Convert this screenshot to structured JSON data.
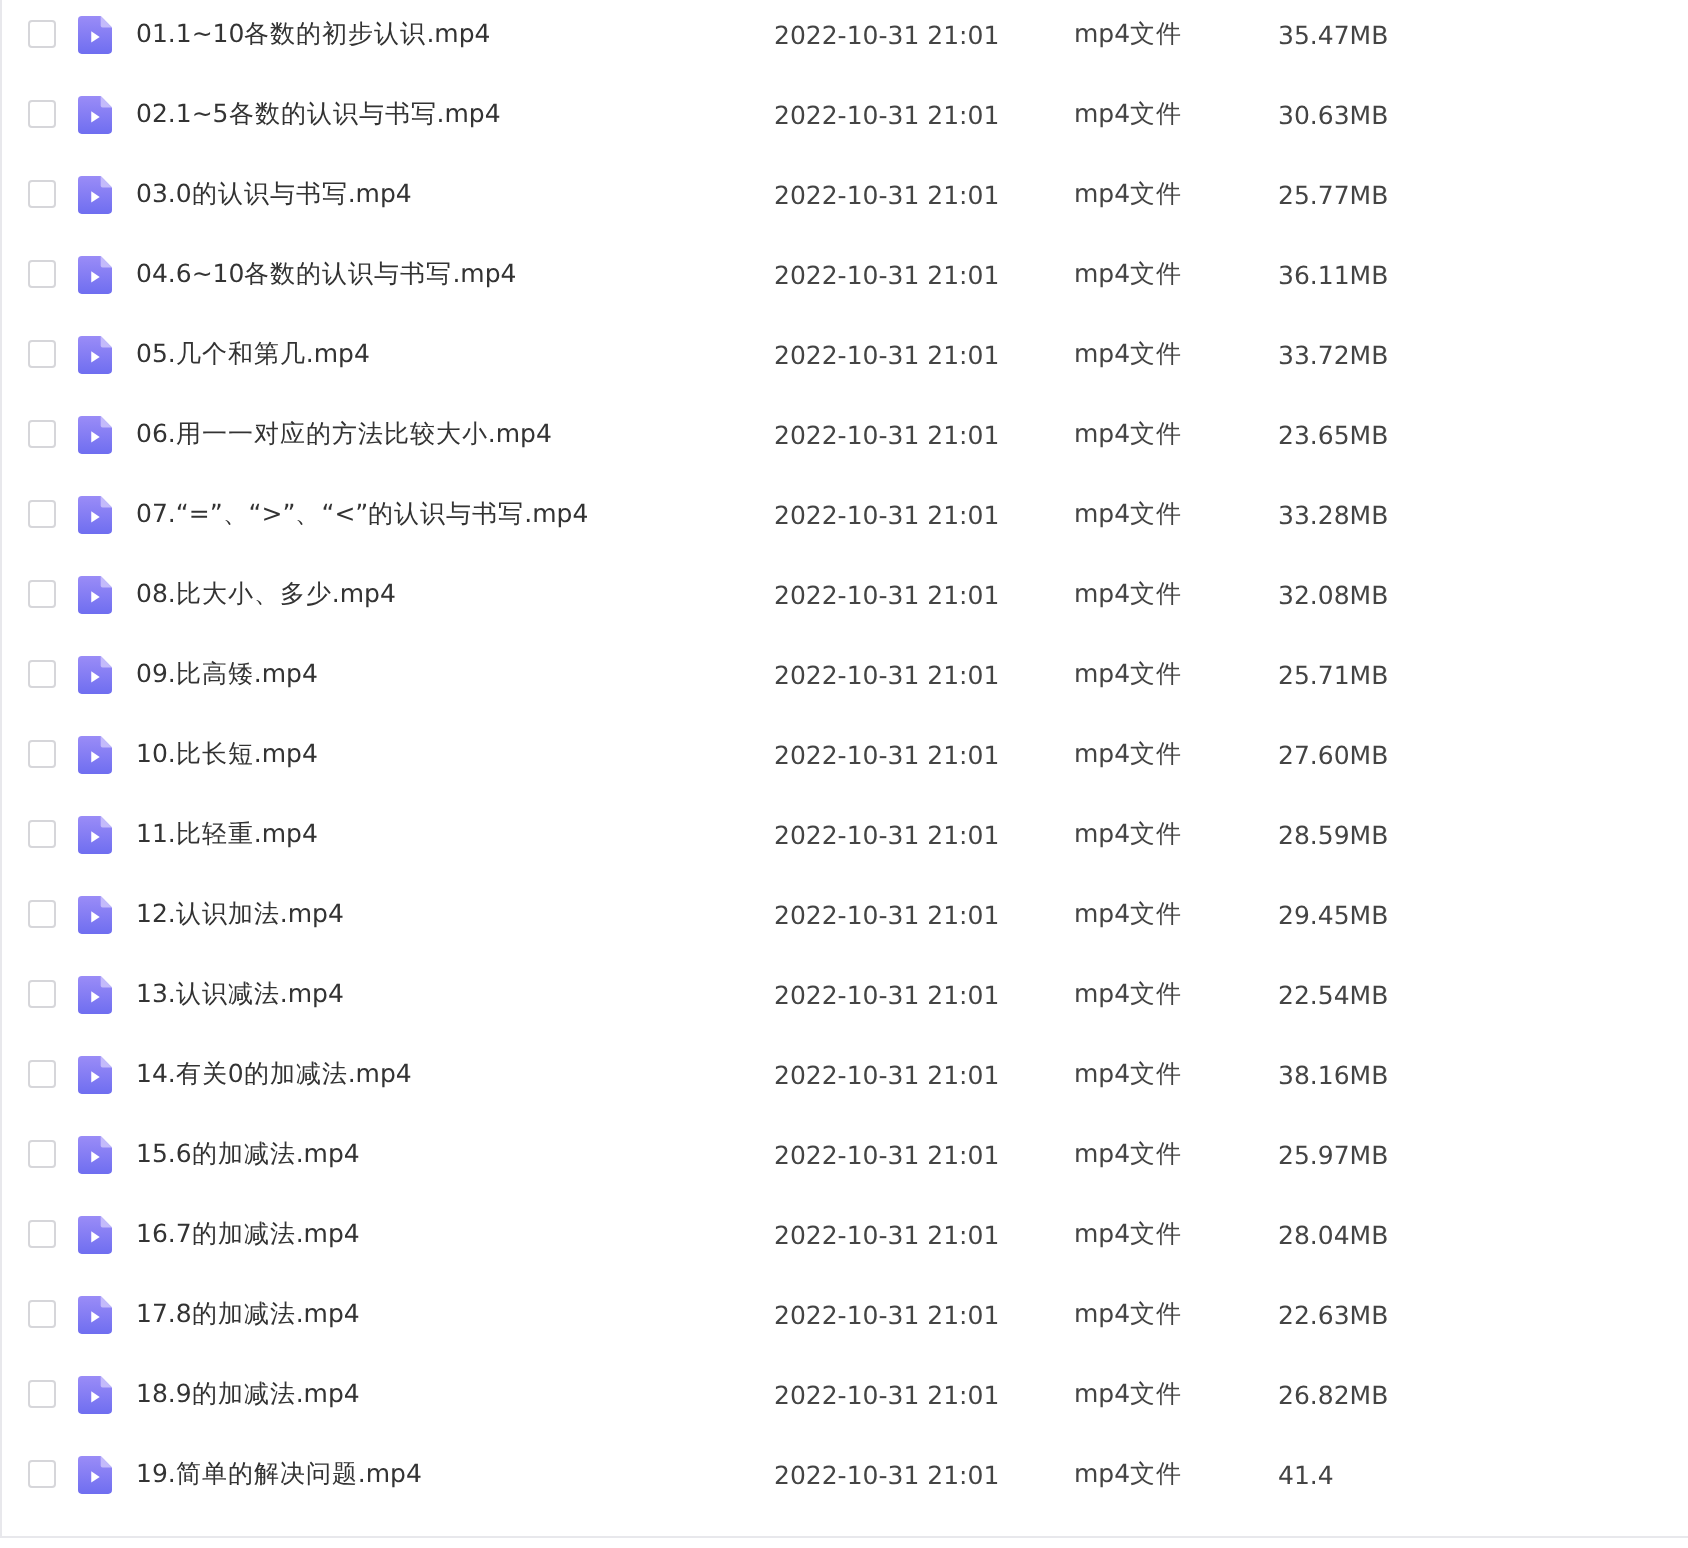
{
  "files": [
    {
      "name": "01.1~10各数的初步认识.mp4",
      "modified": "2022-10-31 21:01",
      "type": "mp4文件",
      "size": "35.47MB",
      "selected": false
    },
    {
      "name": "02.1~5各数的认识与书写.mp4",
      "modified": "2022-10-31 21:01",
      "type": "mp4文件",
      "size": "30.63MB",
      "selected": false
    },
    {
      "name": "03.0的认识与书写.mp4",
      "modified": "2022-10-31 21:01",
      "type": "mp4文件",
      "size": "25.77MB",
      "selected": false
    },
    {
      "name": "04.6~10各数的认识与书写.mp4",
      "modified": "2022-10-31 21:01",
      "type": "mp4文件",
      "size": "36.11MB",
      "selected": false
    },
    {
      "name": "05.几个和第几.mp4",
      "modified": "2022-10-31 21:01",
      "type": "mp4文件",
      "size": "33.72MB",
      "selected": false
    },
    {
      "name": "06.用一一对应的方法比较大小.mp4",
      "modified": "2022-10-31 21:01",
      "type": "mp4文件",
      "size": "23.65MB",
      "selected": false
    },
    {
      "name": "07.“=”、“>”、“<”的认识与书写.mp4",
      "modified": "2022-10-31 21:01",
      "type": "mp4文件",
      "size": "33.28MB",
      "selected": false
    },
    {
      "name": "08.比大小、多少.mp4",
      "modified": "2022-10-31 21:01",
      "type": "mp4文件",
      "size": "32.08MB",
      "selected": false
    },
    {
      "name": "09.比高矮.mp4",
      "modified": "2022-10-31 21:01",
      "type": "mp4文件",
      "size": "25.71MB",
      "selected": false
    },
    {
      "name": "10.比长短.mp4",
      "modified": "2022-10-31 21:01",
      "type": "mp4文件",
      "size": "27.60MB",
      "selected": false
    },
    {
      "name": "11.比轻重.mp4",
      "modified": "2022-10-31 21:01",
      "type": "mp4文件",
      "size": "28.59MB",
      "selected": false
    },
    {
      "name": "12.认识加法.mp4",
      "modified": "2022-10-31 21:01",
      "type": "mp4文件",
      "size": "29.45MB",
      "selected": false
    },
    {
      "name": "13.认识减法.mp4",
      "modified": "2022-10-31 21:01",
      "type": "mp4文件",
      "size": "22.54MB",
      "selected": false
    },
    {
      "name": "14.有关0的加减法.mp4",
      "modified": "2022-10-31 21:01",
      "type": "mp4文件",
      "size": "38.16MB",
      "selected": false
    },
    {
      "name": "15.6的加减法.mp4",
      "modified": "2022-10-31 21:01",
      "type": "mp4文件",
      "size": "25.97MB",
      "selected": false
    },
    {
      "name": "16.7的加减法.mp4",
      "modified": "2022-10-31 21:01",
      "type": "mp4文件",
      "size": "28.04MB",
      "selected": false
    },
    {
      "name": "17.8的加减法.mp4",
      "modified": "2022-10-31 21:01",
      "type": "mp4文件",
      "size": "22.63MB",
      "selected": false
    },
    {
      "name": "18.9的加减法.mp4",
      "modified": "2022-10-31 21:01",
      "type": "mp4文件",
      "size": "26.82MB",
      "selected": false
    },
    {
      "name": "19.简单的解决问题.mp4",
      "modified": "2022-10-31 21:01",
      "type": "mp4文件",
      "size": "41.4",
      "selected": false
    }
  ]
}
